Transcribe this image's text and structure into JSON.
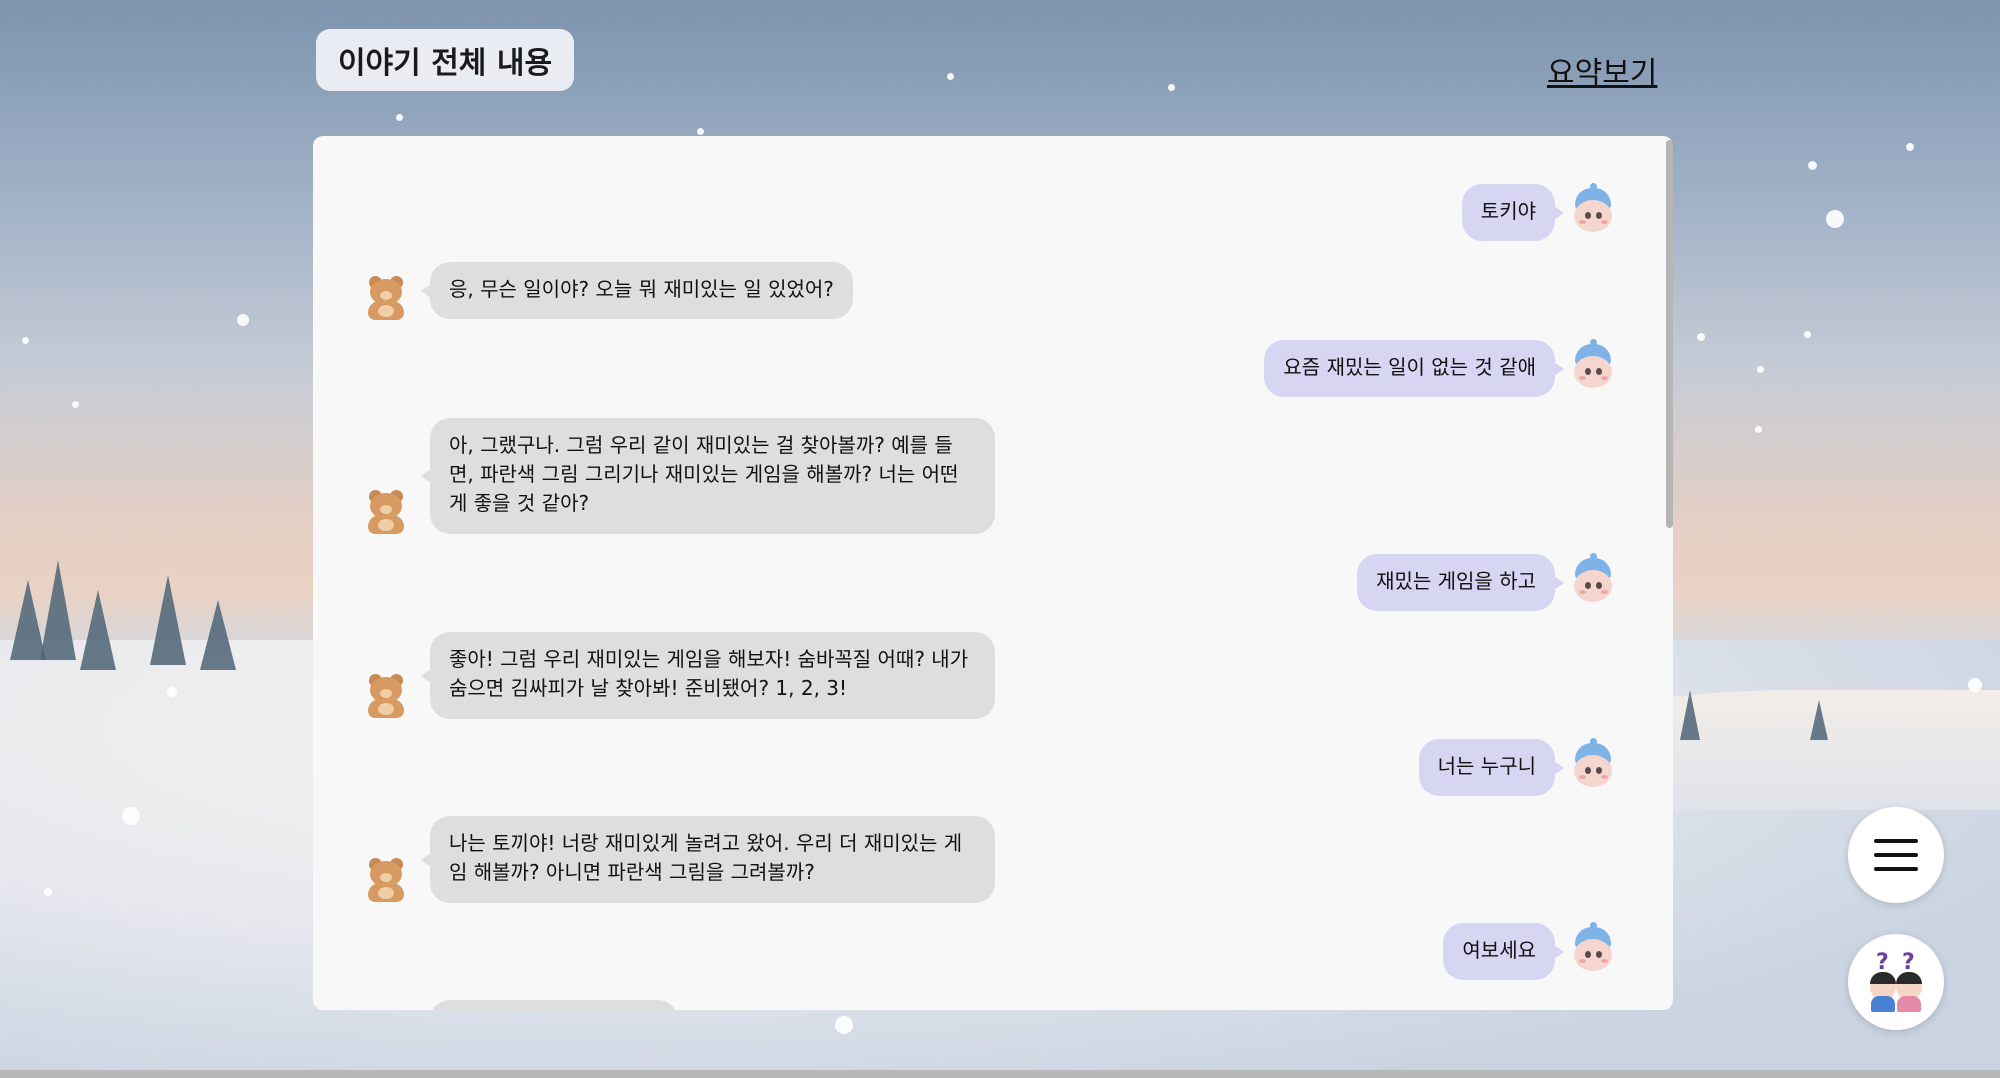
{
  "header": {
    "title": "이야기 전체 내용",
    "summary_link": "요약보기"
  },
  "colors": {
    "user_bubble": "#d6d5f2",
    "bot_bubble": "#dedede",
    "panel": "#f8f8f8",
    "title_chip": "#e9ecf3"
  },
  "messages": [
    {
      "role": "user",
      "text": "토키야"
    },
    {
      "role": "bot",
      "text": "응, 무슨 일이야? 오늘 뭐 재미있는 일 있었어?"
    },
    {
      "role": "user",
      "text": "요즘 재밌는 일이 없는 것 같애"
    },
    {
      "role": "bot",
      "text": "아, 그랬구나. 그럼 우리 같이 재미있는 걸 찾아볼까? 예를 들면, 파란색 그림 그리기나 재미있는 게임을 해볼까? 너는 어떤 게 좋을 것 같아?"
    },
    {
      "role": "user",
      "text": "재밌는 게임을 하고"
    },
    {
      "role": "bot",
      "text": "좋아! 그럼 우리 재미있는 게임을 해보자! 숨바꼭질 어때? 내가 숨으면 김싸피가 날 찾아봐! 준비됐어? 1, 2, 3!"
    },
    {
      "role": "user",
      "text": "너는 누구니"
    },
    {
      "role": "bot",
      "text": "나는 토끼야! 너랑 재미있게 놀려고 왔어. 우리 더 재미있는 게임 해볼까? 아니면 파란색 그림을 그려볼까?"
    },
    {
      "role": "user",
      "text": "여보세요"
    }
  ],
  "icons": {
    "user_avatar": "baby-avatar-icon",
    "bot_avatar": "teddy-bear-icon",
    "menu": "hamburger-menu-icon",
    "help": "question-kids-icon"
  },
  "help_icon_marks": [
    "?",
    "?"
  ]
}
